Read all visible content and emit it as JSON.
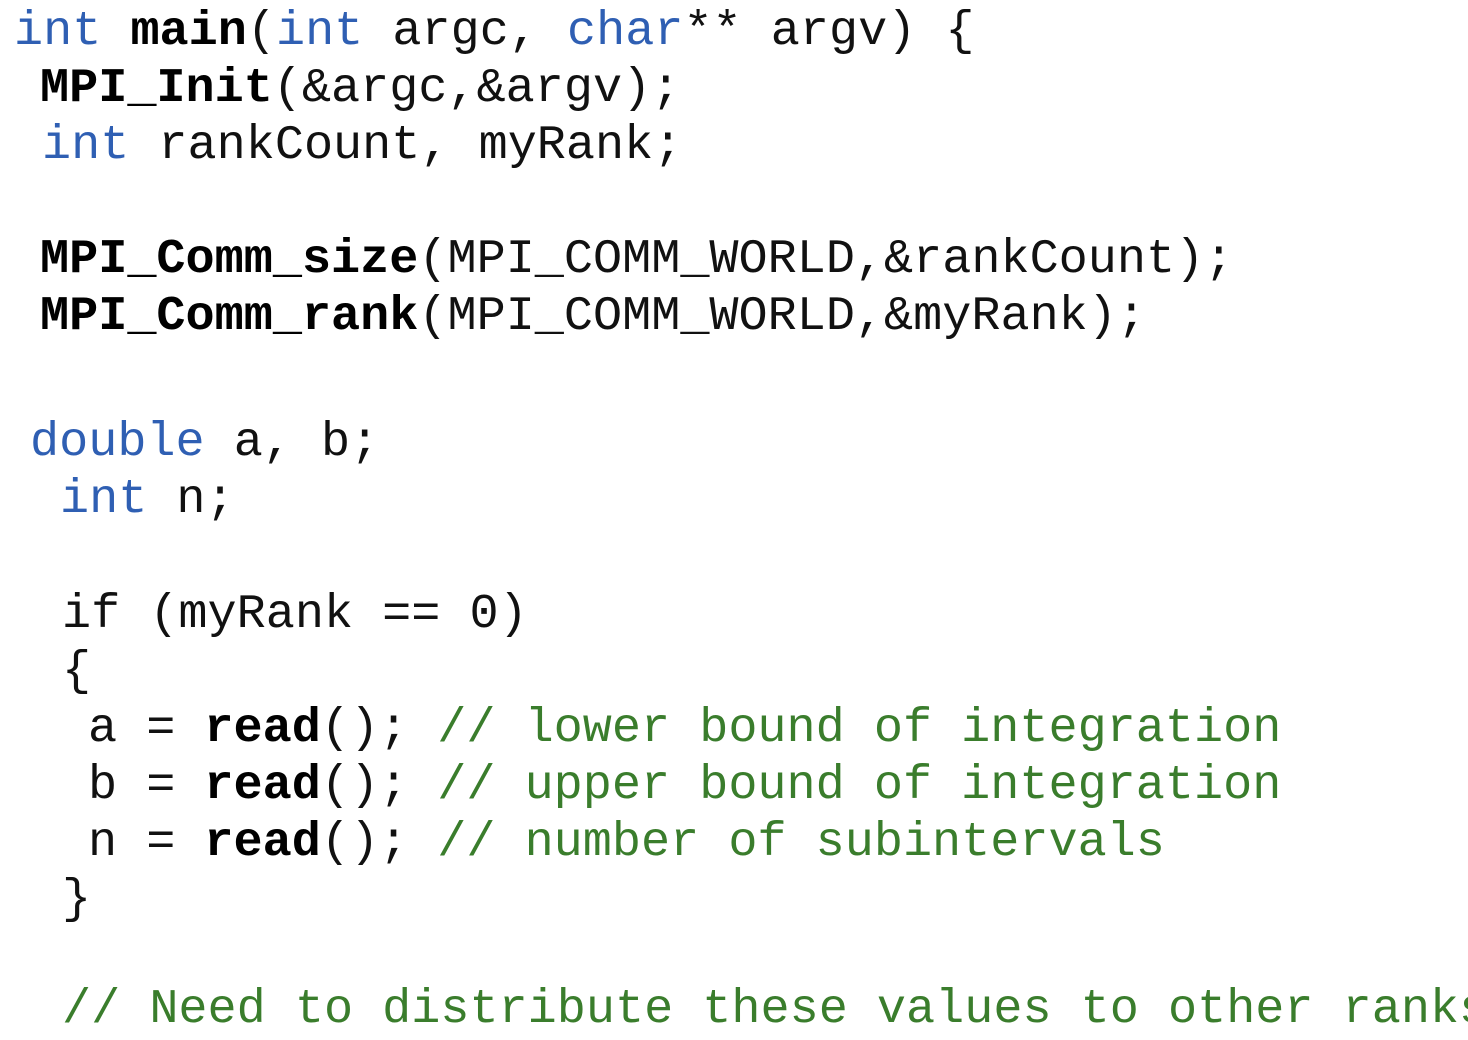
{
  "code": {
    "lines": [
      {
        "id": "l1",
        "tokens": [
          {
            "t": "kw",
            "v": "int"
          },
          {
            "t": "tx",
            "v": " "
          },
          {
            "t": "fn",
            "v": "main"
          },
          {
            "t": "tx",
            "v": "("
          },
          {
            "t": "kw",
            "v": "int"
          },
          {
            "t": "tx",
            "v": " argc, "
          },
          {
            "t": "kw",
            "v": "char"
          },
          {
            "t": "tx",
            "v": "** argv) {"
          }
        ]
      },
      {
        "id": "l2",
        "tokens": [
          {
            "t": "fn",
            "v": "MPI_Init"
          },
          {
            "t": "tx",
            "v": "(&argc,&argv);"
          }
        ]
      },
      {
        "id": "l3",
        "tokens": [
          {
            "t": "kw",
            "v": "int"
          },
          {
            "t": "tx",
            "v": " rankCount, myRank;"
          }
        ]
      },
      {
        "id": "l4",
        "tokens": [
          {
            "t": "fn",
            "v": "MPI_Comm_size"
          },
          {
            "t": "tx",
            "v": "(MPI_COMM_WORLD,&rankCount);"
          }
        ]
      },
      {
        "id": "l5",
        "tokens": [
          {
            "t": "fn",
            "v": "MPI_Comm_rank"
          },
          {
            "t": "tx",
            "v": "(MPI_COMM_WORLD,&myRank);"
          }
        ]
      },
      {
        "id": "l6",
        "tokens": [
          {
            "t": "kw",
            "v": "double"
          },
          {
            "t": "tx",
            "v": " a, b;"
          }
        ]
      },
      {
        "id": "l7",
        "tokens": [
          {
            "t": "kw",
            "v": "int"
          },
          {
            "t": "tx",
            "v": " n;"
          }
        ]
      },
      {
        "id": "l8",
        "tokens": [
          {
            "t": "tx",
            "v": "if (myRank == 0)"
          }
        ]
      },
      {
        "id": "l9",
        "tokens": [
          {
            "t": "tx",
            "v": "{"
          }
        ]
      },
      {
        "id": "l10",
        "tokens": [
          {
            "t": "tx",
            "v": "a = "
          },
          {
            "t": "fn",
            "v": "read"
          },
          {
            "t": "tx",
            "v": "(); "
          },
          {
            "t": "cm",
            "v": "// lower bound of integration"
          }
        ]
      },
      {
        "id": "l11",
        "tokens": [
          {
            "t": "tx",
            "v": "b = "
          },
          {
            "t": "fn",
            "v": "read"
          },
          {
            "t": "tx",
            "v": "(); "
          },
          {
            "t": "cm",
            "v": "// upper bound of integration"
          }
        ]
      },
      {
        "id": "l12",
        "tokens": [
          {
            "t": "tx",
            "v": "n = "
          },
          {
            "t": "fn",
            "v": "read"
          },
          {
            "t": "tx",
            "v": "(); "
          },
          {
            "t": "cm",
            "v": "// number of subintervals"
          }
        ]
      },
      {
        "id": "l13",
        "tokens": [
          {
            "t": "tx",
            "v": "}"
          }
        ]
      },
      {
        "id": "l14",
        "tokens": [
          {
            "t": "cm",
            "v": "// Need to distribute these values to other ranks"
          }
        ]
      }
    ]
  },
  "colors": {
    "keyword": "#2f5fb3",
    "comment": "#3a7d2c",
    "text": "#111111"
  }
}
